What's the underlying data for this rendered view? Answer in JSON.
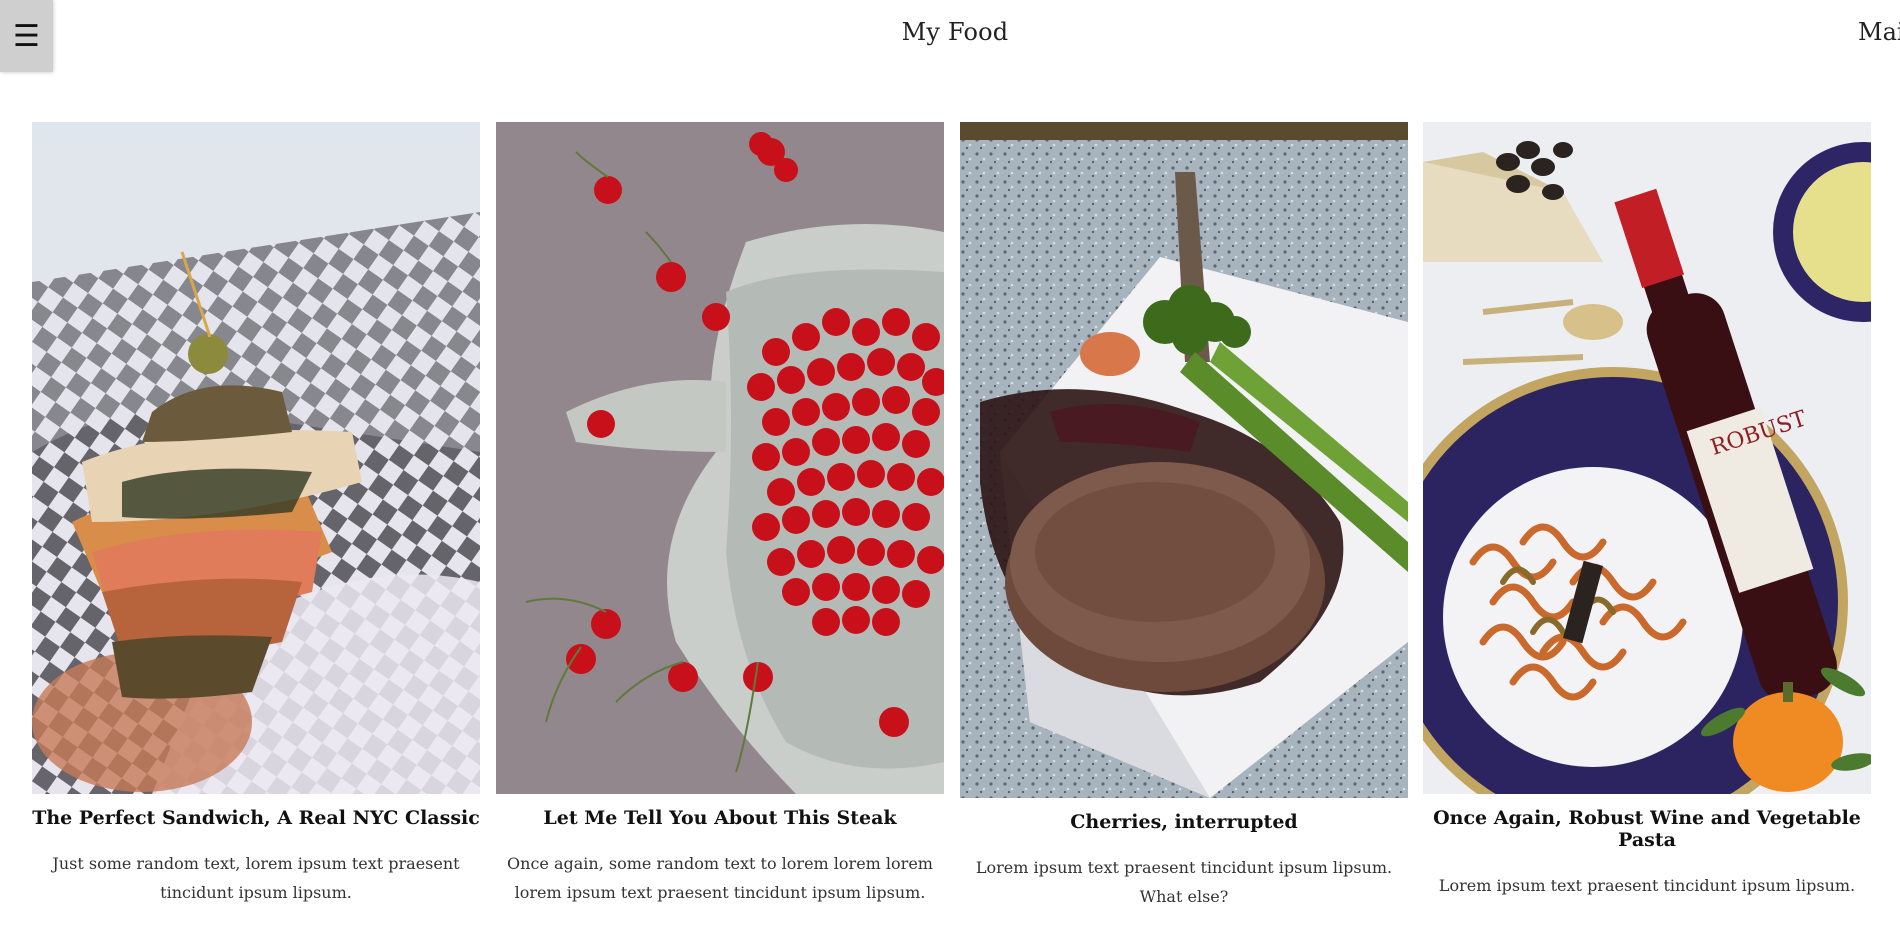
{
  "header": {
    "menu_icon": "☰",
    "title": "My Food",
    "nav_link": "Mail"
  },
  "cards": [
    {
      "image": "sandwich-photo",
      "title": "The Perfect Sandwich, A Real NYC Classic",
      "description": "Just some random text, lorem ipsum text praesent tincidunt ipsum lipsum."
    },
    {
      "image": "cherries-photo",
      "title": "Let Me Tell You About This Steak",
      "description": "Once again, some random text to lorem lorem lorem lorem ipsum text praesent tincidunt ipsum lipsum."
    },
    {
      "image": "steak-photo",
      "title": "Cherries, interrupted",
      "description": "Lorem ipsum text praesent tincidunt ipsum lipsum. What else?"
    },
    {
      "image": "wine-pasta-photo",
      "title": "Once Again, Robust Wine and Vegetable Pasta",
      "description": "Lorem ipsum text praesent tincidunt ipsum lipsum."
    }
  ],
  "colors": {
    "menu_bg": "#cfcfcf",
    "text": "#111111",
    "body_text": "#333333"
  }
}
